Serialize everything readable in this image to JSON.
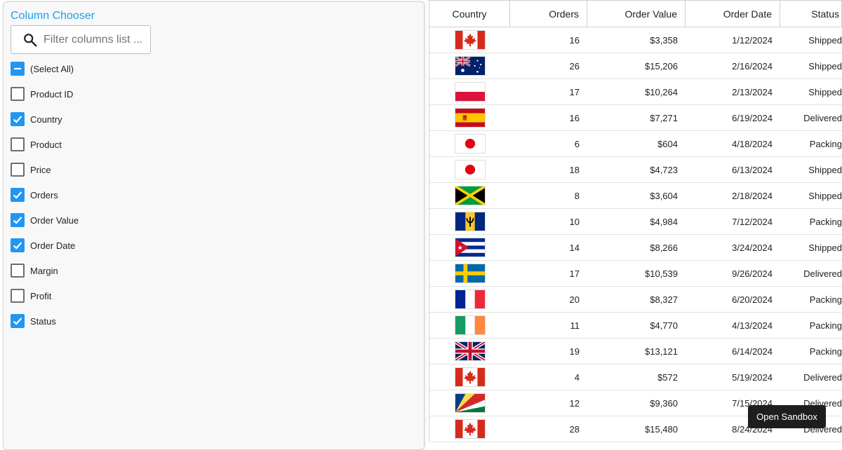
{
  "chooser": {
    "title": "Column Chooser",
    "filter_placeholder": "Filter columns list ...",
    "select_all_label": "(Select All)",
    "columns": [
      {
        "label": "Product ID",
        "checked": false
      },
      {
        "label": "Country",
        "checked": true
      },
      {
        "label": "Product",
        "checked": false
      },
      {
        "label": "Price",
        "checked": false
      },
      {
        "label": "Orders",
        "checked": true
      },
      {
        "label": "Order Value",
        "checked": true
      },
      {
        "label": "Order Date",
        "checked": true
      },
      {
        "label": "Margin",
        "checked": false
      },
      {
        "label": "Profit",
        "checked": false
      },
      {
        "label": "Status",
        "checked": true
      }
    ]
  },
  "grid": {
    "headers": {
      "country": "Country",
      "orders": "Orders",
      "value": "Order Value",
      "date": "Order Date",
      "status": "Status"
    },
    "rows": [
      {
        "flag": "canada",
        "orders": "16",
        "value": "$3,358",
        "date": "1/12/2024",
        "status": "Shipped"
      },
      {
        "flag": "australia",
        "orders": "26",
        "value": "$15,206",
        "date": "2/16/2024",
        "status": "Shipped"
      },
      {
        "flag": "poland",
        "orders": "17",
        "value": "$10,264",
        "date": "2/13/2024",
        "status": "Shipped"
      },
      {
        "flag": "spain",
        "orders": "16",
        "value": "$7,271",
        "date": "6/19/2024",
        "status": "Delivered"
      },
      {
        "flag": "japan",
        "orders": "6",
        "value": "$604",
        "date": "4/18/2024",
        "status": "Packing"
      },
      {
        "flag": "japan",
        "orders": "18",
        "value": "$4,723",
        "date": "6/13/2024",
        "status": "Shipped"
      },
      {
        "flag": "jamaica",
        "orders": "8",
        "value": "$3,604",
        "date": "2/18/2024",
        "status": "Shipped"
      },
      {
        "flag": "barbados",
        "orders": "10",
        "value": "$4,984",
        "date": "7/12/2024",
        "status": "Packing"
      },
      {
        "flag": "cuba",
        "orders": "14",
        "value": "$8,266",
        "date": "3/24/2024",
        "status": "Shipped"
      },
      {
        "flag": "sweden",
        "orders": "17",
        "value": "$10,539",
        "date": "9/26/2024",
        "status": "Delivered"
      },
      {
        "flag": "france",
        "orders": "20",
        "value": "$8,327",
        "date": "6/20/2024",
        "status": "Packing"
      },
      {
        "flag": "ireland",
        "orders": "11",
        "value": "$4,770",
        "date": "4/13/2024",
        "status": "Packing"
      },
      {
        "flag": "uk",
        "orders": "19",
        "value": "$13,121",
        "date": "6/14/2024",
        "status": "Packing"
      },
      {
        "flag": "canada",
        "orders": "4",
        "value": "$572",
        "date": "5/19/2024",
        "status": "Delivered"
      },
      {
        "flag": "seychelles",
        "orders": "12",
        "value": "$9,360",
        "date": "7/15/2024",
        "status": "Delivered"
      },
      {
        "flag": "canada",
        "orders": "28",
        "value": "$15,480",
        "date": "8/24/2024",
        "status": "Delivered"
      }
    ]
  },
  "sandbox_button": "Open Sandbox",
  "colors": {
    "accent": "#2196f3",
    "title": "#1aa0e8"
  }
}
